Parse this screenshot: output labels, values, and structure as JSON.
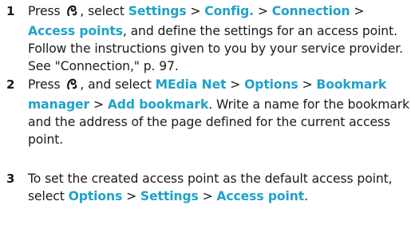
{
  "steps": [
    {
      "number": "1",
      "t0": "Press",
      "t1": ", select",
      "menu1": "Settings",
      "sep1": ">",
      "menu2": "Config.",
      "sep2": ">",
      "menu3": "Connection",
      "sep3": ">",
      "menu4": "Access points",
      "t2": ", and define the settings for an access point. Follow the instructions given to you by your service provider. See \"Connection,\" p. 97."
    },
    {
      "number": "2",
      "t0": "Press",
      "t1": ", and select",
      "menu1": "MEdia Net",
      "sep1": ">",
      "menu2": "Options",
      "sep2": ">",
      "menu3": "Bookmark manager",
      "sep3": ">",
      "menu4": "Add bookmark",
      "t2": ". Write a name for the bookmark and the address of the page defined for the current access point."
    },
    {
      "number": "3",
      "t0": "To set the created access point as the default access point, select",
      "menu1": "Options",
      "sep1": ">",
      "menu2": "Settings",
      "sep2": ">",
      "menu3": "Access point",
      "t2": "."
    }
  ],
  "icons": {
    "menu_key": "menu-key-icon"
  },
  "colors": {
    "highlight": "#1fa2c9",
    "text": "#1a1a1a"
  }
}
